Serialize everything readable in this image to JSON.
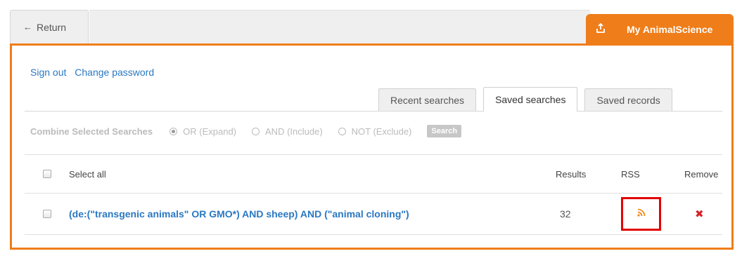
{
  "nav": {
    "return_label": "Return",
    "return_icon": "arrow-left-icon",
    "my_label": "My AnimalScience",
    "my_icon": "export-icon"
  },
  "account": {
    "sign_out": "Sign out",
    "change_password": "Change password"
  },
  "tabs": [
    {
      "label": "Recent searches",
      "active": false
    },
    {
      "label": "Saved searches",
      "active": true
    },
    {
      "label": "Saved records",
      "active": false
    }
  ],
  "combine": {
    "label": "Combine Selected Searches",
    "options": [
      {
        "label": "OR (Expand)",
        "checked": true
      },
      {
        "label": "AND (Include)",
        "checked": false
      },
      {
        "label": "NOT (Exclude)",
        "checked": false
      }
    ],
    "search_button": "Search"
  },
  "table": {
    "select_all": "Select all",
    "col_results": "Results",
    "col_rss": "RSS",
    "col_remove": "Remove",
    "rows": [
      {
        "query": "(de:(\"transgenic animals\" OR GMO*) AND sheep) AND (\"animal cloning\")",
        "results": "32",
        "rss_icon": "rss-feed-icon",
        "remove_icon": "close-icon"
      }
    ]
  },
  "colors": {
    "accent": "#ef7d1a",
    "link": "#2a78c2",
    "highlight": "#e30000",
    "remove": "#d8232a"
  }
}
